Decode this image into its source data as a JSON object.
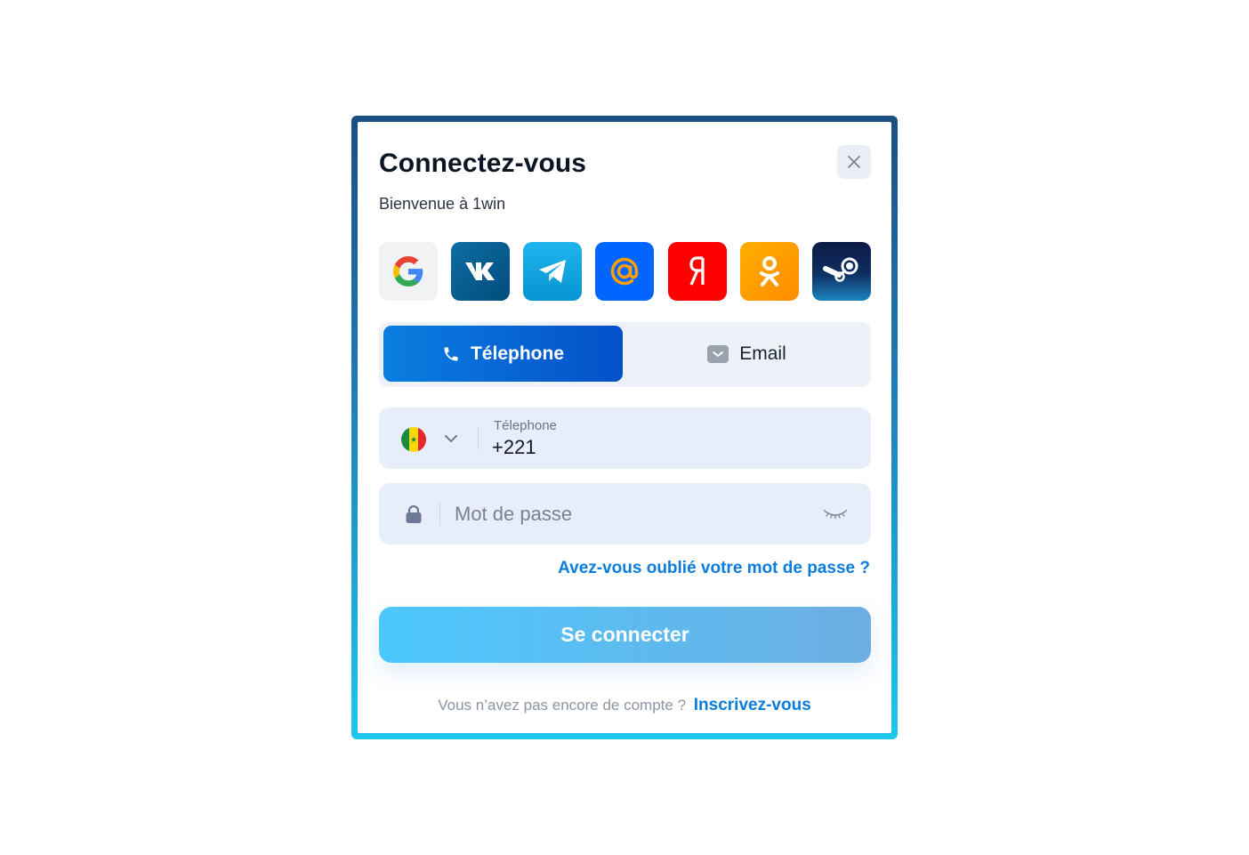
{
  "modal": {
    "title": "Connectez-vous",
    "subtitle": "Bienvenue à 1win",
    "close_icon": "close-icon"
  },
  "social_logins": [
    {
      "name": "Google",
      "icon": "google-icon",
      "color": "#f1f2f4"
    },
    {
      "name": "VK",
      "icon": "vk-icon",
      "color": "#0d6da3"
    },
    {
      "name": "Telegram",
      "icon": "telegram-icon",
      "color": "#21b3ec"
    },
    {
      "name": "Mail.ru",
      "icon": "mail-ru-icon",
      "color": "#0066ff"
    },
    {
      "name": "Yandex",
      "icon": "yandex-icon",
      "color": "#ff0000"
    },
    {
      "name": "Odnoklassniki",
      "icon": "odnoklassniki-icon",
      "color": "#ff9e00"
    },
    {
      "name": "Steam",
      "icon": "steam-icon",
      "color": "#0b1a44"
    }
  ],
  "tabs": [
    {
      "label": "Télephone",
      "icon": "phone-icon",
      "active": true
    },
    {
      "label": "Email",
      "icon": "envelope-icon",
      "active": false
    }
  ],
  "phone_field": {
    "country": "Senegal",
    "flag_icon": "senegal-flag-icon",
    "label": "Télephone",
    "value": "+221"
  },
  "password_field": {
    "placeholder": "Mot de passe",
    "value": ""
  },
  "forgot_password": "Avez-vous oublié votre mot de passe ?",
  "login_button": "Se connecter",
  "footer": {
    "text": "Vous n’avez pas encore de compte ?",
    "link": "Inscrivez-vous"
  },
  "colors": {
    "accent": "#0a7ddc",
    "active_tab": "#0450c8",
    "field_bg": "#e8eef9"
  }
}
